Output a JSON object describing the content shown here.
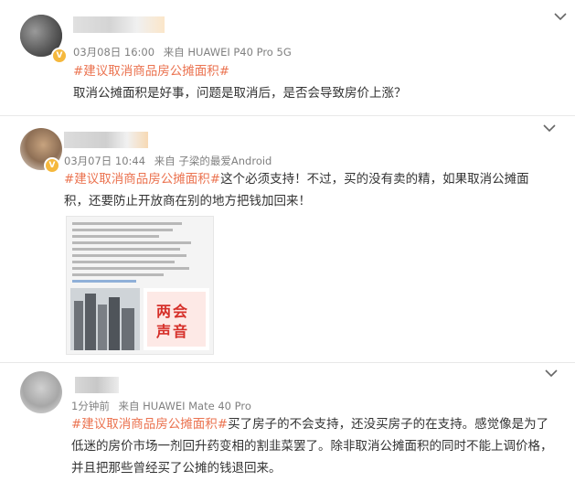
{
  "posts": [
    {
      "meta": {
        "date": "03月08日 16:00",
        "source": "来自 HUAWEI P40 Pro 5G"
      },
      "hashtag": "#建议取消商品房公摊面积#",
      "text": "取消公摊面积是好事，问题是取消后，是否会导致房价上涨？"
    },
    {
      "meta": {
        "date": "03月07日 10:44",
        "source": "来自 子梁的最爱Android"
      },
      "hashtag": "#建议取消商品房公摊面积#",
      "text": "这个必须支持！不过，买的没有卖的精，如果取消公摊面积，还要防止开放商在别的地方把钱加回来！",
      "image": {
        "badge_line1": "两会",
        "badge_line2": "声音"
      }
    },
    {
      "meta": {
        "date": "1分钟前",
        "source": "来自 HUAWEI Mate 40 Pro"
      },
      "hashtag": "#建议取消商品房公摊面积#",
      "text": "买了房子的不会支持，还没买房子的在支持。感觉像是为了低迷的房价市场一剂回升药变相的割韭菜罢了。除非取消公摊面积的同时不能上调价格，并且把那些曾经买了公摊的钱退回来。"
    }
  ],
  "icons": {
    "expand": "chevron-down-icon",
    "verified": "v-badge-icon"
  },
  "colors": {
    "hashtag": "#eb7350",
    "meta": "#808080",
    "text": "#333333",
    "badge": "#f5b83d"
  }
}
